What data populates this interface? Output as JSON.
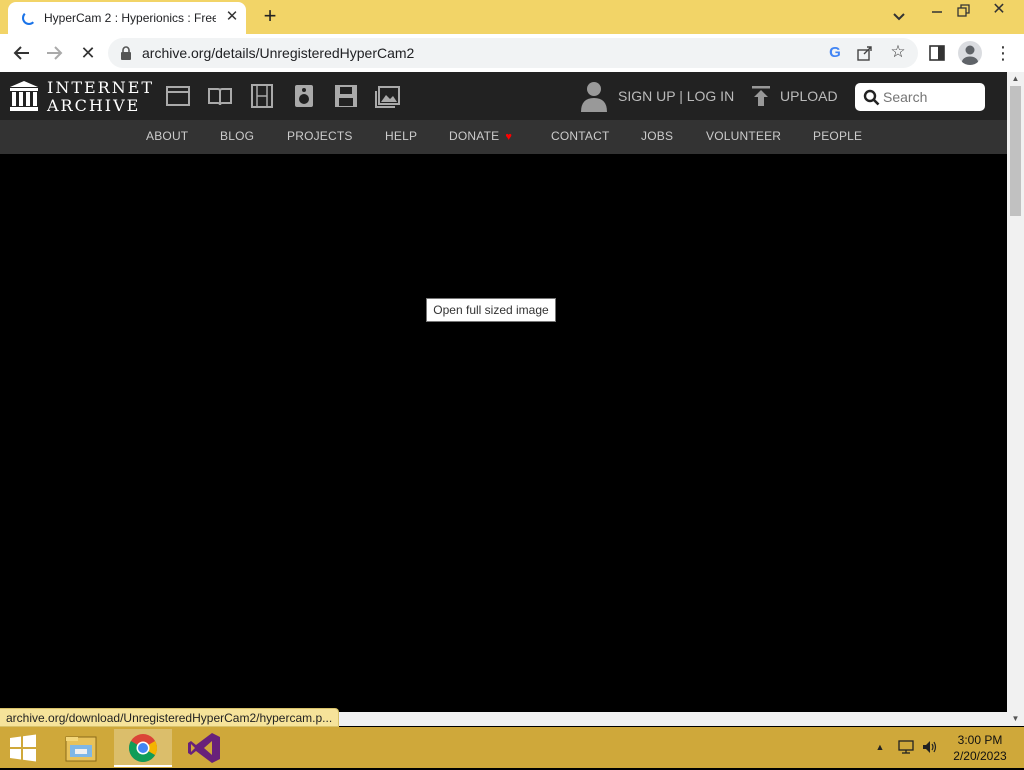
{
  "browser": {
    "tab_title": "HyperCam 2 : Hyperionics : Free",
    "new_tab_label": "+",
    "url": "archive.org/details/UnregisteredHyperCam2",
    "status_text": "archive.org/download/UnregisteredHyperCam2/hypercam.p..."
  },
  "archive": {
    "logo_line1": "INTERNET",
    "logo_line2": "ARCHIVE",
    "media_icons": [
      "web-icon",
      "texts-icon",
      "video-icon",
      "audio-icon",
      "software-icon",
      "images-icon"
    ],
    "signup_label": "SIGN UP | LOG IN",
    "upload_label": "UPLOAD",
    "search_placeholder": "Search",
    "nav": [
      "ABOUT",
      "BLOG",
      "PROJECTS",
      "HELP",
      "DONATE",
      "CONTACT",
      "JOBS",
      "VOLUNTEER",
      "PEOPLE"
    ],
    "donate_heart": "♥",
    "tooltip": "Open full sized image"
  },
  "taskbar": {
    "apps": [
      "start-icon",
      "file-explorer-icon",
      "chrome-icon",
      "visual-studio-icon"
    ],
    "time": "3:00 PM",
    "date": "2/20/2023"
  },
  "colors": {
    "taskbar": "#cfa83a",
    "tabstrip": "#f2d467",
    "archive_header": "#222222",
    "archive_nav": "#333333",
    "donate_heart": "#ff0000"
  }
}
